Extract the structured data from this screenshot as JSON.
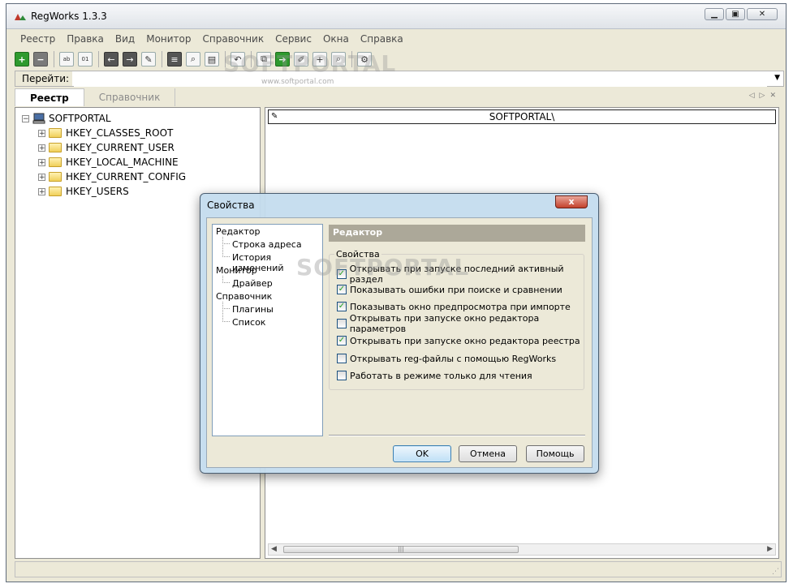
{
  "window": {
    "title": "RegWorks 1.3.3"
  },
  "menu": [
    "Реестр",
    "Правка",
    "Вид",
    "Монитор",
    "Справочник",
    "Сервис",
    "Окна",
    "Справка"
  ],
  "goto": {
    "label": "Перейти:",
    "value": ""
  },
  "watermark": {
    "brand": "SOFTPORTAL",
    "url": "www.softportal.com"
  },
  "tabs": [
    {
      "label": "Реестр",
      "active": true
    },
    {
      "label": "Справочник",
      "active": false
    }
  ],
  "tree": {
    "root": "SOFTPORTAL",
    "items": [
      "HKEY_CLASSES_ROOT",
      "HKEY_CURRENT_USER",
      "HKEY_LOCAL_MACHINE",
      "HKEY_CURRENT_CONFIG",
      "HKEY_USERS"
    ]
  },
  "path": {
    "value": "SOFTPORTAL\\"
  },
  "dialog": {
    "title": "Свойства",
    "close_label": "x",
    "nav": [
      "Редактор",
      "Строка адреса",
      "История изменений",
      "Монитор",
      "Драйвер",
      "Справочник",
      "Плагины",
      "Список"
    ],
    "header": "Редактор",
    "group_label": "Свойства",
    "options": [
      {
        "label": "Открывать при запуске последний активный раздел",
        "checked": true
      },
      {
        "label": "Показывать ошибки при поиске и сравнении",
        "checked": true
      },
      {
        "label": "Показывать окно предпросмотра при импорте",
        "checked": true
      },
      {
        "label": "Открывать при запуске окно редактора параметров",
        "checked": false
      },
      {
        "label": "Открывать при запуске окно редактора реестра",
        "checked": true
      },
      {
        "label": "Открывать reg-файлы с помощью RegWorks",
        "checked": false
      },
      {
        "label": "Работать в режиме только для чтения",
        "checked": false
      }
    ],
    "buttons": {
      "ok": "OK",
      "cancel": "Отмена",
      "help": "Помощь"
    }
  }
}
